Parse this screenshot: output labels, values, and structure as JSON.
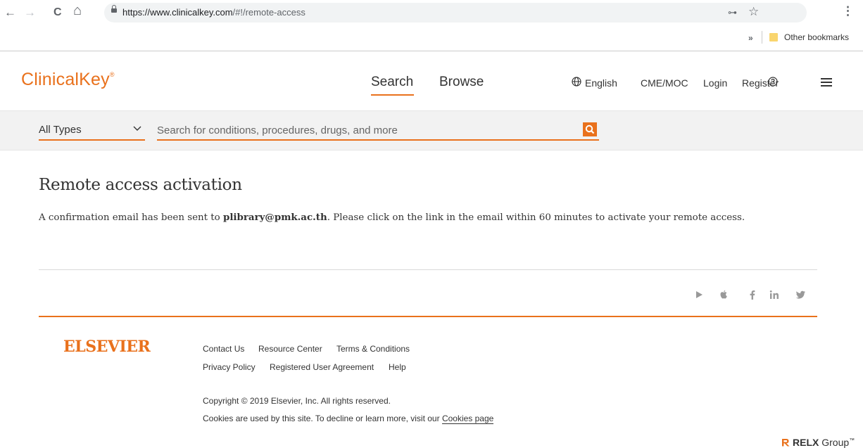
{
  "browser": {
    "back_glyph": "←",
    "forward_glyph": "→",
    "reload_glyph": "C",
    "home_glyph": "⌂",
    "url_host": "https://www.clinicalkey.com",
    "url_path": "/#!/remote-access",
    "key_glyph": "⊶",
    "star_glyph": "☆",
    "menu_glyph": "⋮",
    "bookmarks_chevron": "»",
    "bookmark_folder": "Other bookmarks"
  },
  "header": {
    "logo": "ClinicalKey",
    "logo_mark": "®",
    "nav": {
      "search": "Search",
      "browse": "Browse"
    },
    "language": "English",
    "cme": "CME/MOC",
    "login": "Login",
    "register": "Register"
  },
  "search": {
    "type_selected": "All Types",
    "placeholder": "Search for conditions, procedures, drugs, and more"
  },
  "main": {
    "title": "Remote access activation",
    "message_prefix": "A confirmation email has been sent to ",
    "email": "plibrary@pmk.ac.th",
    "message_suffix": ". Please click on the link in the email within 60 minutes to activate your remote access."
  },
  "social": {
    "play": "play-store-icon",
    "apple": "apple-icon",
    "facebook": "facebook-icon",
    "linkedin": "linkedin-icon",
    "twitter": "twitter-icon"
  },
  "footer": {
    "brand": "ELSEVIER",
    "links_row1": {
      "contact": "Contact Us",
      "resource": "Resource Center",
      "terms": "Terms & Conditions"
    },
    "links_row2": {
      "privacy": "Privacy Policy",
      "agreement": "Registered User Agreement",
      "help": "Help"
    },
    "copyright": "Copyright © 2019 Elsevier, Inc. All rights reserved.",
    "cookies_text": "Cookies are used by this site. To decline or learn more, visit our ",
    "cookies_link": "Cookies page",
    "relx_bold": "RELX",
    "relx_rest": " Group",
    "relx_tm": "™"
  },
  "colors": {
    "accent": "#e9711c",
    "strip": "#f2f2f2",
    "text": "#333333"
  }
}
